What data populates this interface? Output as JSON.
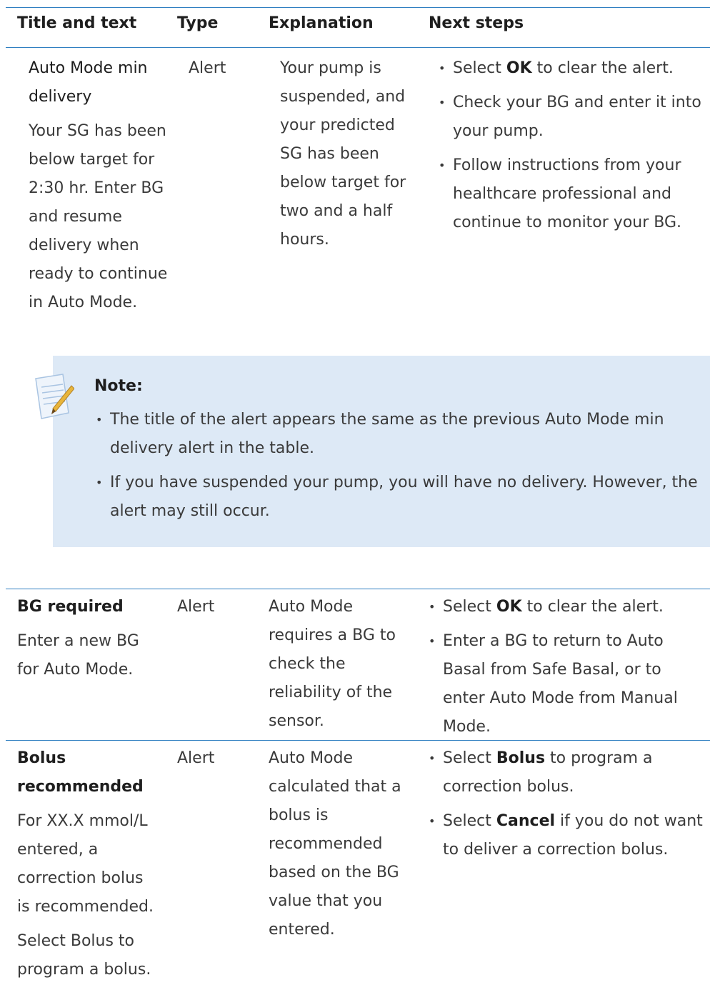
{
  "headers": [
    "Title and text",
    "Type",
    "Explanation",
    "Next steps"
  ],
  "rows": [
    {
      "title": "Auto Mode min delivery",
      "text": [
        "Your SG has been below target for 2:30 hr. Enter BG and resume delivery when ready to continue in Auto Mode."
      ],
      "type": "Alert",
      "explanation": "Your pump is suspended, and your predicted SG has been below target for two and a half hours.",
      "steps": [
        {
          "pre": "Select ",
          "bold": "OK",
          "post": " to clear the alert."
        },
        {
          "pre": "Check your BG and enter it into your pump.",
          "bold": "",
          "post": ""
        },
        {
          "pre": "Follow instructions from your healthcare professional and continue to monitor your BG.",
          "bold": "",
          "post": ""
        }
      ]
    },
    {
      "title": "BG required",
      "text": [
        "Enter a new BG for Auto Mode."
      ],
      "type": "Alert",
      "explanation": "Auto Mode requires a BG to check the reliability of the sensor.",
      "steps": [
        {
          "pre": "Select ",
          "bold": "OK",
          "post": " to clear the alert."
        },
        {
          "pre": "Enter a BG to return to Auto Basal from Safe Basal, or to enter Auto Mode from Manual Mode.",
          "bold": "",
          "post": ""
        }
      ]
    },
    {
      "title": "Bolus recommended",
      "text": [
        "For XX.X mmol/L entered, a correction bolus is recommended.",
        "Select Bolus to program a bolus."
      ],
      "type": "Alert",
      "explanation": "Auto Mode calculated that a bolus is recommended based on the BG value that you entered.",
      "steps": [
        {
          "pre": "Select ",
          "bold": "Bolus",
          "post": " to program a correction bolus."
        },
        {
          "pre": "Select ",
          "bold": "Cancel",
          "post": " if you do not want to deliver a correction bolus."
        }
      ]
    }
  ],
  "note": {
    "title": "Note:",
    "items": [
      "The title of the alert appears the same as the previous Auto Mode min delivery alert in the table.",
      "If you have suspended your pump, you will have no delivery. However, the alert may still occur."
    ]
  },
  "colors": {
    "rule": "#2f7fc1",
    "note_bg": "#dde9f6"
  },
  "icons": {
    "note": "notepad-pencil-icon"
  }
}
